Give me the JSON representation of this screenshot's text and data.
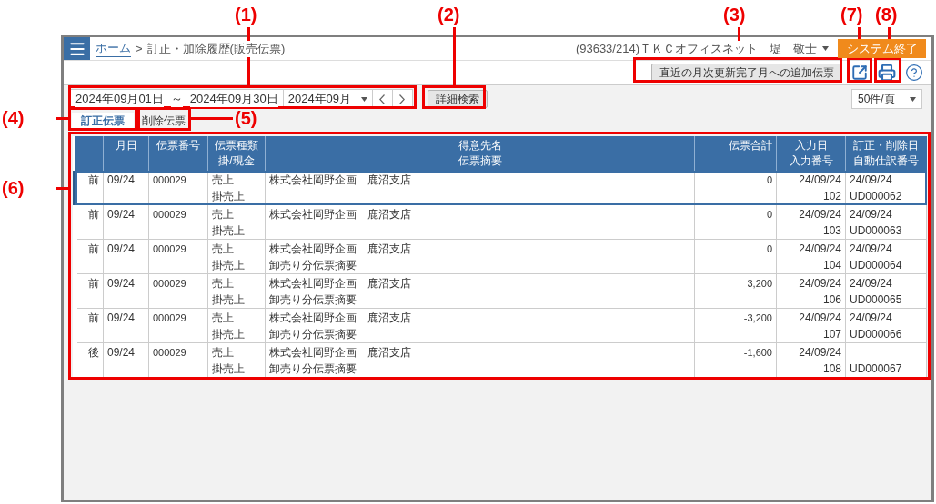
{
  "header": {
    "breadcrumb_link": "ホーム",
    "breadcrumb_separator": ">",
    "page_title": "訂正・加除履歴(販売伝票)",
    "user": "(93633/214)ＴＫＣオフィスネット　堤　敬士",
    "exit_button": "システム終了"
  },
  "toolbar": {
    "additional_button": "直近の月次更新完了月への追加伝票"
  },
  "filter": {
    "date_from": "2024年09月01日",
    "range_separator": "～",
    "date_to": "2024年09月30日",
    "month": "2024年09月",
    "search_button": "詳細検索",
    "page_size": "50件/頁"
  },
  "tabs": [
    {
      "label": "訂正伝票",
      "selected": true
    },
    {
      "label": "削除伝票",
      "selected": false
    }
  ],
  "table": {
    "columns": [
      {
        "lines": [
          "月日"
        ]
      },
      {
        "lines": [
          "伝票番号"
        ]
      },
      {
        "lines": [
          "伝票種類",
          "掛/現金"
        ]
      },
      {
        "lines": [
          "得意先名",
          "伝票摘要"
        ]
      },
      {
        "lines": [
          "伝票合計"
        ]
      },
      {
        "lines": [
          "入力日",
          "入力番号"
        ]
      },
      {
        "lines": [
          "訂正・削除日",
          "自動仕訳番号"
        ]
      }
    ],
    "rows": [
      {
        "selected": true,
        "version": "前",
        "date": "09/24",
        "number": "000029",
        "type": "売上",
        "payment": "掛売上",
        "customer": "株式会社岡野企画　鹿沼支店",
        "total": "0",
        "input_date": "24/09/24",
        "input_no": "102",
        "correction_date": "24/09/24",
        "journal_no": "UD000062"
      },
      {
        "selected": false,
        "version": "前",
        "date": "09/24",
        "number": "000029",
        "type": "売上",
        "payment": "掛売上",
        "customer": "株式会社岡野企画　鹿沼支店",
        "total": "0",
        "input_date": "24/09/24",
        "input_no": "103",
        "correction_date": "24/09/24",
        "journal_no": "UD000063"
      },
      {
        "selected": false,
        "version": "前",
        "date": "09/24",
        "number": "000029",
        "type": "売上",
        "payment": "掛売上",
        "customer": "株式会社岡野企画　鹿沼支店",
        "memo": "卸売り分伝票摘要",
        "total": "0",
        "input_date": "24/09/24",
        "input_no": "104",
        "correction_date": "24/09/24",
        "journal_no": "UD000064"
      },
      {
        "selected": false,
        "version": "前",
        "date": "09/24",
        "number": "000029",
        "type": "売上",
        "payment": "掛売上",
        "customer": "株式会社岡野企画　鹿沼支店",
        "memo": "卸売り分伝票摘要",
        "total": "3,200",
        "input_date": "24/09/24",
        "input_no": "106",
        "correction_date": "24/09/24",
        "journal_no": "UD000065"
      },
      {
        "selected": false,
        "version": "前",
        "date": "09/24",
        "number": "000029",
        "type": "売上",
        "payment": "掛売上",
        "customer": "株式会社岡野企画　鹿沼支店",
        "memo": "卸売り分伝票摘要",
        "total": "-3,200",
        "input_date": "24/09/24",
        "input_no": "107",
        "correction_date": "24/09/24",
        "journal_no": "UD000066"
      },
      {
        "selected": false,
        "version": "後",
        "date": "09/24",
        "number": "000029",
        "type": "売上",
        "payment": "掛売上",
        "customer": "株式会社岡野企画　鹿沼支店",
        "memo": "卸売り分伝票摘要",
        "total": "-1,600",
        "input_date": "24/09/24",
        "input_no": "108",
        "journal_no": "UD000067"
      }
    ]
  },
  "annotations": [
    {
      "label": "(1)"
    },
    {
      "label": "(2)"
    },
    {
      "label": "(3)"
    },
    {
      "label": "(7)"
    },
    {
      "label": "(8)"
    },
    {
      "label": "(4)"
    },
    {
      "label": "(5)"
    },
    {
      "label": "(6)"
    }
  ]
}
